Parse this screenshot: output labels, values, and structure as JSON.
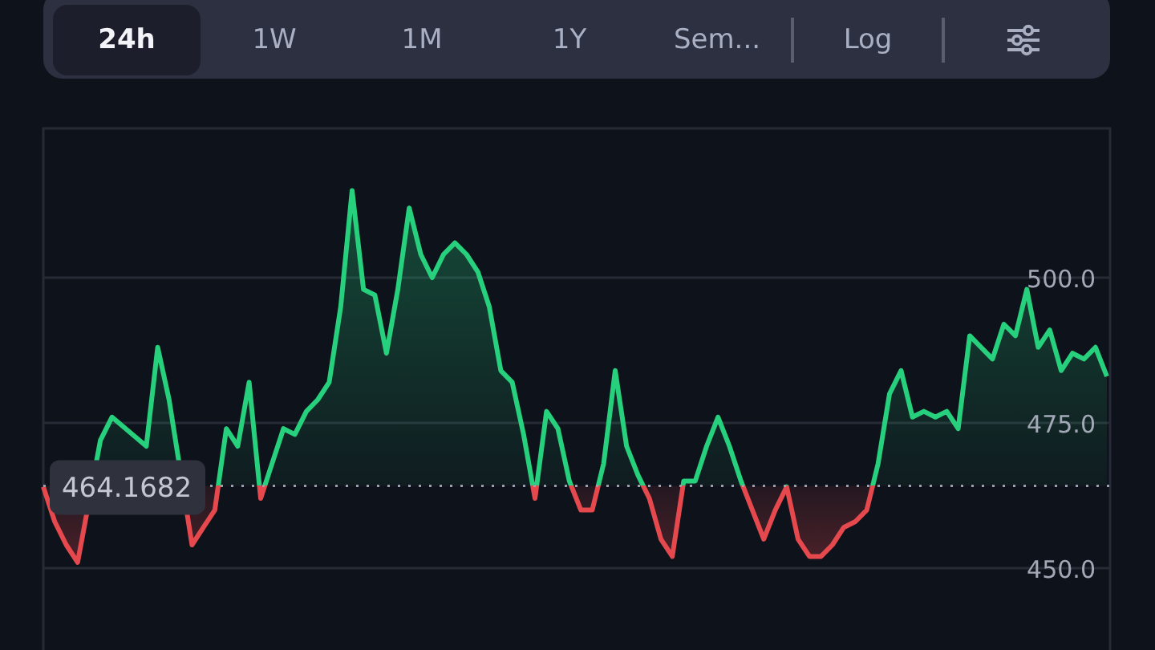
{
  "toolbar": {
    "tabs": [
      {
        "label": "24h",
        "selected": true
      },
      {
        "label": "1W",
        "selected": false
      },
      {
        "label": "1M",
        "selected": false
      },
      {
        "label": "1Y",
        "selected": false
      },
      {
        "label": "Sem...",
        "selected": false
      }
    ],
    "log_button": {
      "label": "Log"
    }
  },
  "chart": {
    "chart_data": {
      "type": "area",
      "grid": true,
      "ylim": [
        435.9,
        525.7
      ],
      "yticks": [
        {
          "value": 450,
          "label": "450.0"
        },
        {
          "value": 475,
          "label": "475.0"
        },
        {
          "value": 500,
          "label": "500.0"
        }
      ],
      "series": [
        {
          "color": "#26d07c",
          "values": [
            464,
            458,
            454,
            451,
            null,
            472,
            476,
            null,
            null,
            471,
            488,
            479,
            null,
            454,
            457,
            460,
            474,
            471,
            482,
            462,
            468,
            474,
            473,
            477,
            479,
            482,
            495,
            515,
            498,
            497,
            487,
            498,
            512,
            504,
            500,
            504,
            506,
            504,
            501,
            495,
            484,
            482,
            473,
            462,
            477,
            474,
            465,
            460,
            460,
            468,
            484,
            471,
            466,
            462,
            455,
            452,
            465,
            465,
            471,
            476,
            471,
            465,
            460,
            455,
            460,
            464,
            455,
            452,
            452,
            454,
            457,
            458,
            460,
            468,
            480,
            484,
            476,
            477,
            476,
            477,
            474,
            490,
            488,
            486,
            492,
            490,
            498,
            488,
            491,
            484,
            487,
            486,
            488,
            483
          ]
        }
      ],
      "ref_lines": [
        {
          "axis": "y",
          "value": 464.1682,
          "label": "464.1682"
        }
      ]
    }
  }
}
